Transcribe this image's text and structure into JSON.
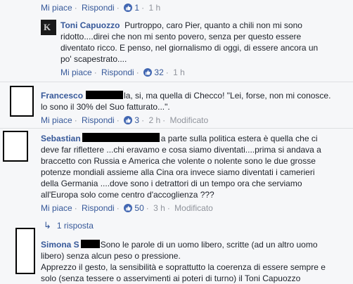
{
  "top": {
    "like": "Mi piace",
    "reply": "Rispondi",
    "count": "1",
    "time": "1 h"
  },
  "c1": {
    "name": "Toni Capuozzo",
    "lines": [
      "Purtroppo, caro Pier, quanto a chili non mi sono",
      "ridotto....direi che non mi sento povero, senza per questo essere",
      "diventato ricco. E penso, nel giornalismo di oggi, di essere ancora un",
      "po' scapestrato...."
    ],
    "like": "Mi piace",
    "reply": "Rispondi",
    "count": "32",
    "time": "1 h"
  },
  "c2": {
    "name": "Francesco",
    "line1_tail": "la, si, ma quella di Checco! \"Lei, forse, non mi conosce.",
    "line2": "lo sono il 30% del Suo fatturato...\".",
    "like": "Mi piace",
    "reply": "Rispondi",
    "count": "3",
    "time": "2 h",
    "edited": "Modificato"
  },
  "c3": {
    "name": "Sebastian",
    "line1_tail": "a parte sulla politica estera è quella che ci",
    "lines": [
      "deve far riflettere ...chi eravamo e cosa siamo diventati....prima si andava a",
      "braccetto con Russia e America che volente o nolente sono le due grosse",
      "potenze mondiali assieme alla Cina ora invece siamo diventati i camerieri",
      "della Germania ....dove sono i detrattori di un tempo ora che serviamo",
      "all'Europa solo come centro d'accoglienza ???"
    ],
    "like": "Mi piace",
    "reply": "Rispondi",
    "count": "50",
    "time": "3 h",
    "edited": "Modificato",
    "replies": "1 risposta"
  },
  "c4": {
    "name": "Simona S",
    "line1_tail": "Sono le parole di un uomo libero, scritte (ad un altro uomo",
    "lines": [
      "libero) senza alcun peso o pressione.",
      "Apprezzo il gesto, la sensibilità e soprattutto la coerenza di essere sempre e",
      "solo (senza tessere o asservimenti ai poteri di turno) il Toni Capuozzo"
    ]
  },
  "colors": {
    "link": "#365899",
    "like_blue": "#4267b2",
    "text": "#1d2129",
    "meta": "#90949c"
  }
}
